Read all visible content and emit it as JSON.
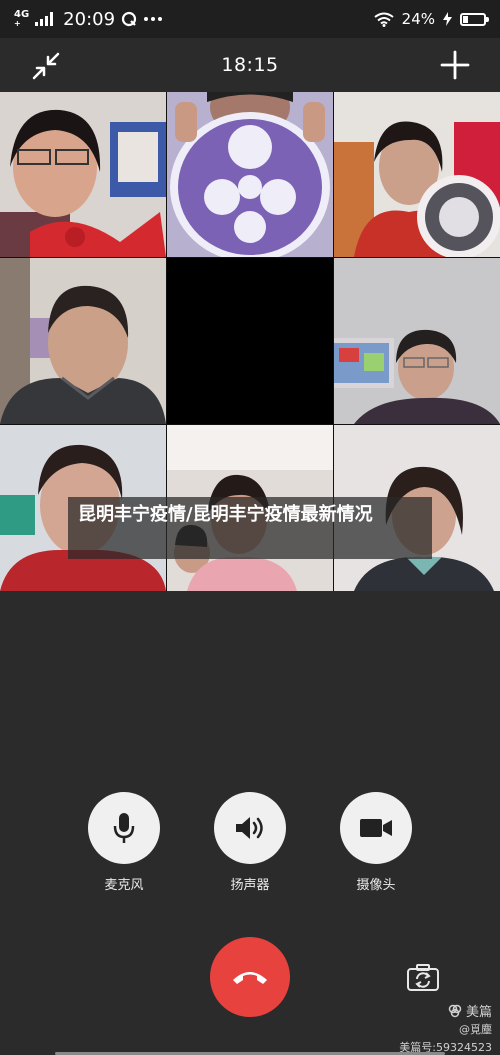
{
  "status_bar": {
    "network": "4G",
    "network_sub": "+",
    "time": "20:09",
    "battery": "24%",
    "battery_level": 0.24,
    "icons": [
      "signal-icon",
      "notification-icon",
      "more-icon",
      "wifi-icon",
      "charging-icon",
      "battery-icon"
    ]
  },
  "call": {
    "duration": "18:15",
    "icons": [
      "minimize-icon",
      "add-participant-icon"
    ]
  },
  "caption": "昆明丰宁疫情/昆明丰宁疫情最新情况",
  "controls": {
    "mic_label": "麦克风",
    "speaker_label": "扬声器",
    "camera_label": "摄像头",
    "icons": [
      "microphone-icon",
      "speaker-icon",
      "video-camera-icon",
      "hang-up-icon",
      "switch-camera-icon"
    ]
  },
  "colors": {
    "background": "#2b2b2b",
    "hangup": "#e8423f",
    "control_button": "#f0f0f0"
  },
  "watermark": {
    "brand": "美篇",
    "user": "@覓塵",
    "id": "美篇号:59324523"
  }
}
